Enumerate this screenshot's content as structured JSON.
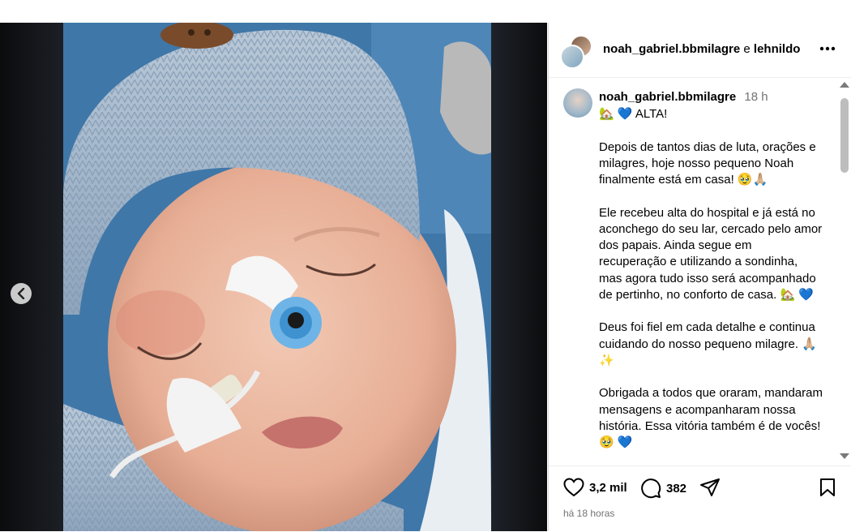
{
  "header": {
    "author": "noah_gabriel.bbmilagre",
    "joiner": "e",
    "coauthor": "lehnildo"
  },
  "caption": {
    "user": "noah_gabriel.bbmilagre",
    "time": "18 h",
    "text": "🏡 💙 ALTA!\n\nDepois de tantos dias de luta, orações e milagres, hoje nosso pequeno Noah finalmente está em casa! 🥹🙏🏼\n\nEle recebeu alta do hospital e já está no aconchego do seu lar, cercado pelo amor dos papais. Ainda segue em recuperação e utilizando a sondinha, mas agora tudo isso será acompanhado de pertinho, no conforto de casa. 🏡 💙\n\nDeus foi fiel em cada detalhe e continua cuidando do nosso pequeno milagre. 🙏🏼✨\n\nObrigada a todos que oraram, mandaram mensagens e acompanharam nossa história. Essa vitória também é de vocês! 🥹 💙"
  },
  "actions": {
    "likes": "3,2 mil",
    "comments": "382"
  },
  "posted": "há 18 horas",
  "colors": {
    "muted_text": "#737373",
    "divider": "#dbdbdb",
    "hat": "#9fb4c9",
    "blanket": "#4f86b6"
  },
  "icons": {
    "prev": "chevron-left-icon",
    "more": "more-options-icon",
    "like": "heart-icon",
    "comment": "comment-icon",
    "share": "share-icon",
    "save": "bookmark-icon"
  }
}
